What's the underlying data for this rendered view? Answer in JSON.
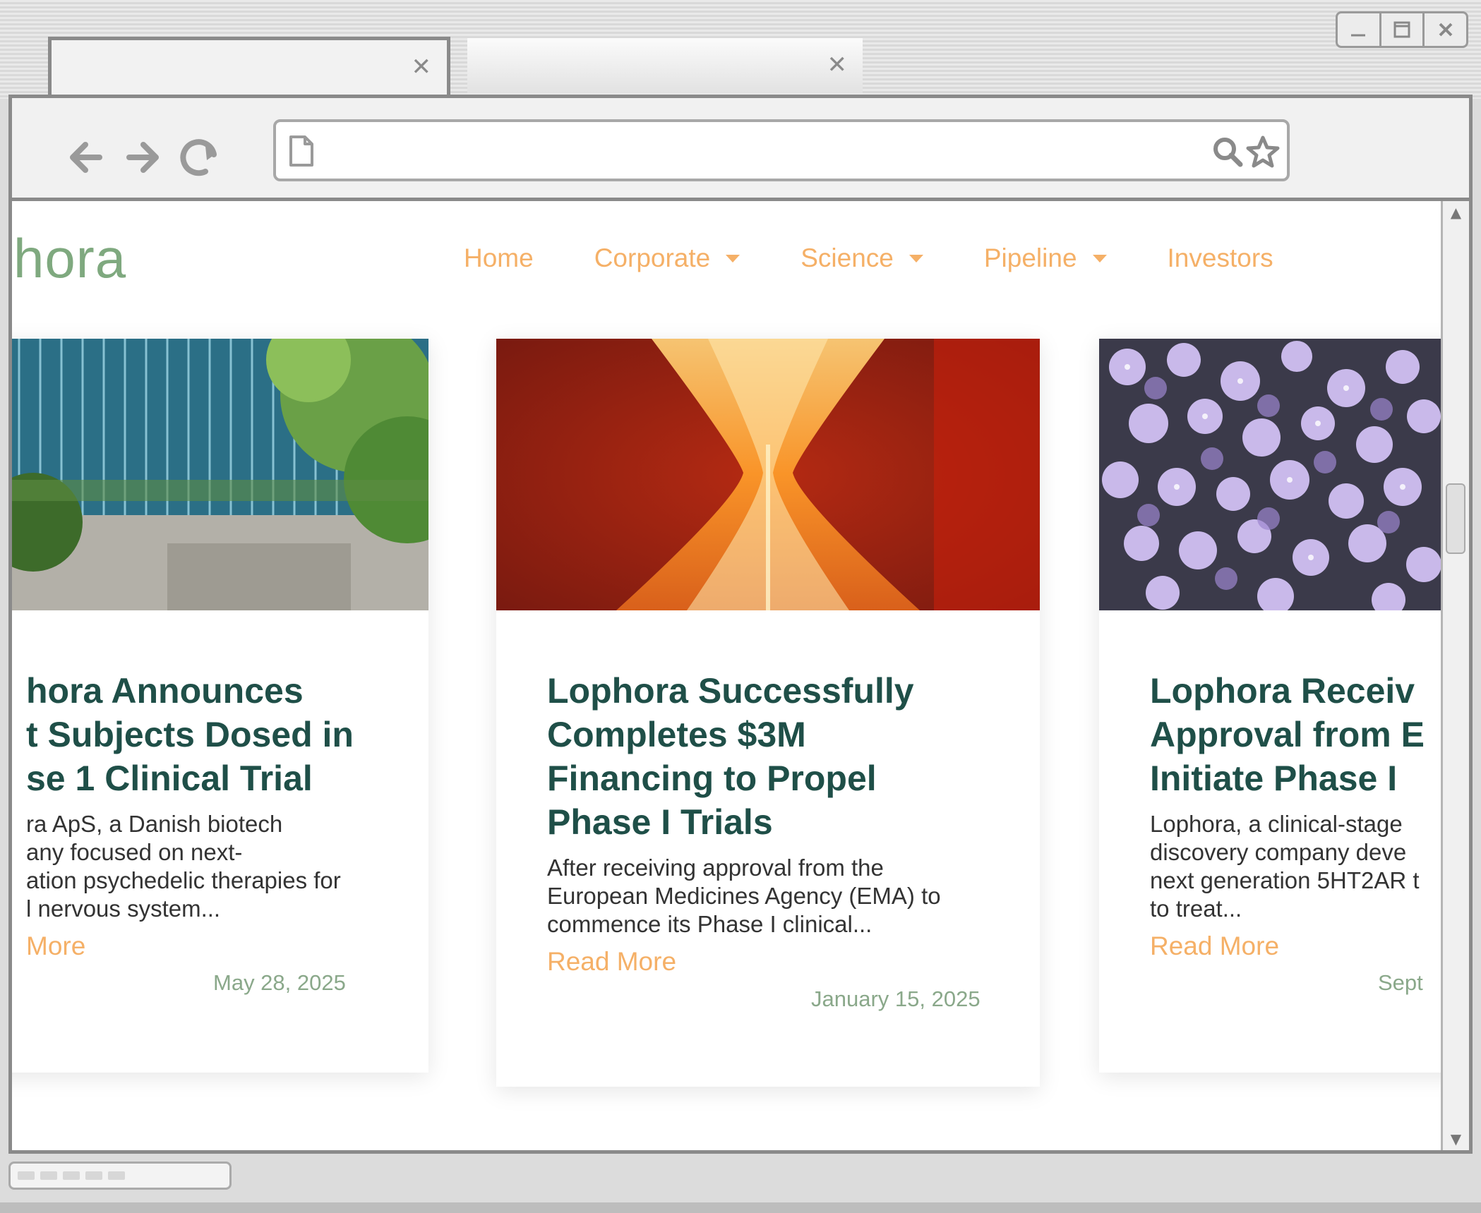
{
  "window": {
    "controls": [
      "minimize",
      "maximize",
      "close"
    ],
    "tabs": [
      {
        "label": "",
        "state": "active"
      },
      {
        "label": "",
        "state": "inactive"
      }
    ],
    "address_bar": {
      "value": ""
    }
  },
  "site": {
    "logo": "hora",
    "nav": [
      {
        "label": "Home",
        "has_dropdown": false
      },
      {
        "label": "Corporate",
        "has_dropdown": true
      },
      {
        "label": "Science",
        "has_dropdown": true
      },
      {
        "label": "Pipeline",
        "has_dropdown": true
      },
      {
        "label": "Investors",
        "has_dropdown": false
      }
    ]
  },
  "cards": [
    {
      "title": "hora Announces\nt Subjects Dosed in\nse 1 Clinical Trial",
      "excerpt": "ra ApS, a Danish biotech\nany focused on next-\nation psychedelic therapies for\nl nervous system...",
      "read_more": "More",
      "date": "May 28, 2025",
      "image": "glass-building"
    },
    {
      "title": "Lophora Successfully\nCompletes $3M\nFinancing to Propel\nPhase I Trials",
      "excerpt": "After receiving approval from the\nEuropean Medicines Agency (EMA) to\ncommence its Phase I clinical...",
      "read_more": "Read More",
      "date": "January 15, 2025",
      "image": "hourglass"
    },
    {
      "title": "Lophora Receiv\nApproval from E\nInitiate Phase I",
      "excerpt": "Lophora, a clinical-stage\ndiscovery company deve\nnext generation 5HT2AR t\nto treat...",
      "read_more": "Read More",
      "date": "Sept",
      "image": "purple-flowers"
    }
  ]
}
